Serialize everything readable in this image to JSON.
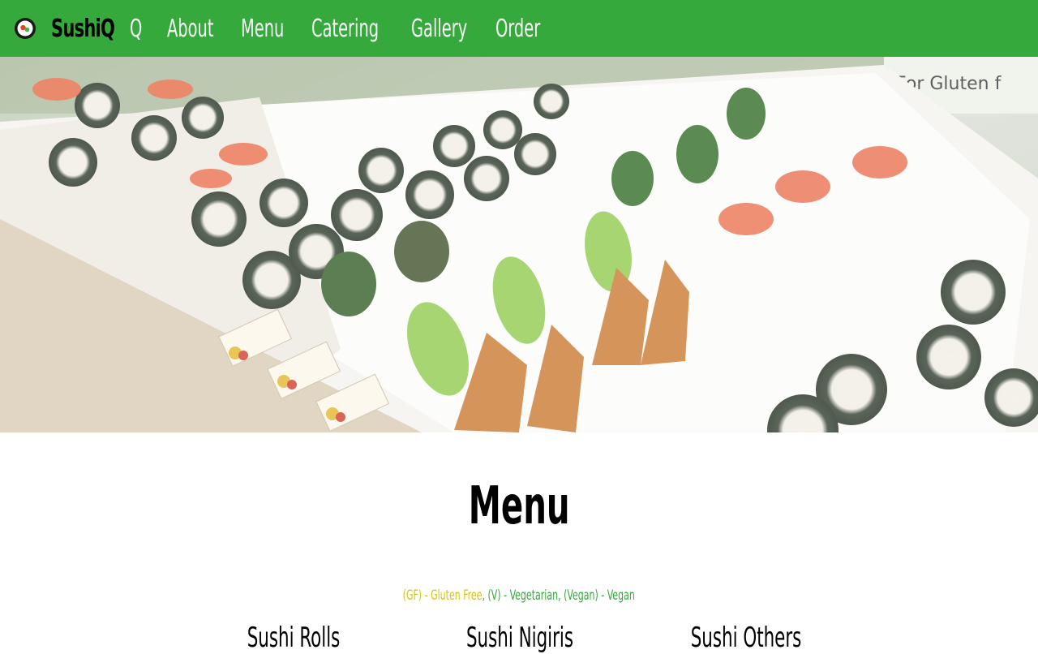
{
  "brand": {
    "name": "SushiQ",
    "logo_icon": "sushi-roll-logo-icon"
  },
  "nav": {
    "items": [
      {
        "label": "Q"
      },
      {
        "label": "About"
      },
      {
        "label": "Menu"
      },
      {
        "label": "Catering"
      },
      {
        "label": "Gallery"
      },
      {
        "label": "Order"
      }
    ]
  },
  "hero": {
    "image": "sushi-display-photo"
  },
  "menu": {
    "title": "Menu",
    "legend": {
      "gf": "(GF) - Gluten Free",
      "sep1": ", ",
      "v": "(V) - Vegetarian",
      "sep2": ", ",
      "vegan": "(Vegan) - Vegan"
    },
    "categories": [
      {
        "title": "Sushi Rolls"
      },
      {
        "title": "Sushi Nigiris"
      },
      {
        "title": "Sushi Others"
      }
    ]
  },
  "colors": {
    "navbar": "#36a93c",
    "gluten_free": "#d3c21c",
    "vegetarian": "#36a93c"
  }
}
